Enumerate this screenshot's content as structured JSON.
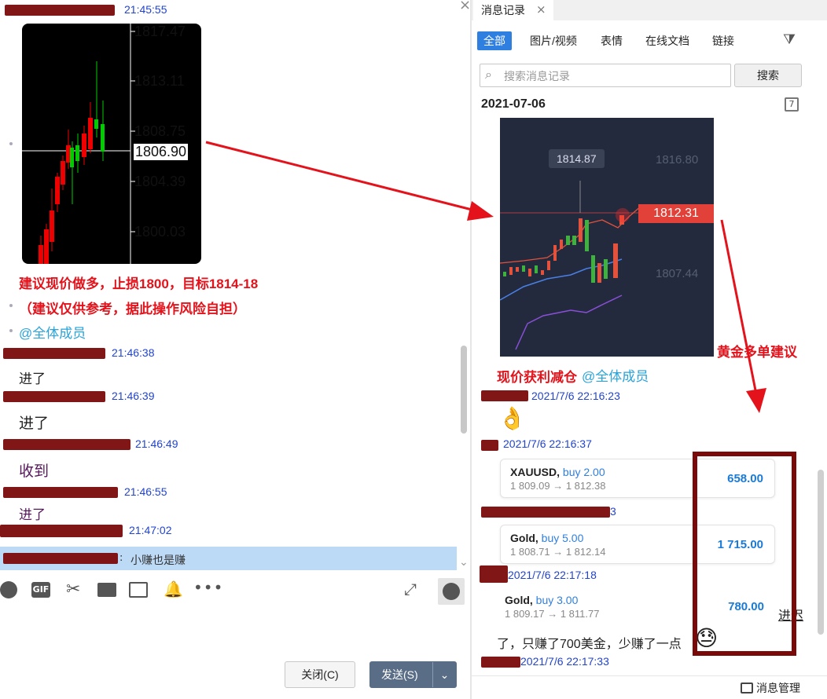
{
  "left": {
    "header_time": "21:45:55",
    "chart1": {
      "prices": [
        "1817.47",
        "1813.11",
        "1808.75",
        "1806.90",
        "1804.39",
        "1800.03"
      ]
    },
    "suggestion_line1": "建议现价做多，止损1800，目标1814-18",
    "suggestion_line2": "（建议仅供参考，据此操作风险自担）",
    "mention": "@全体成员",
    "messages": [
      {
        "time": "21:46:38",
        "text": "进了"
      },
      {
        "time": "21:46:39",
        "text": "进了"
      },
      {
        "time": "21:46:49",
        "text": "收到"
      },
      {
        "time": "21:46:55",
        "text": "进了"
      }
    ],
    "last_time": "21:47:02",
    "quote_text": "小赚也是赚",
    "toolbar_gif": "GIF",
    "close_button": "关闭(C)",
    "send_button": "发送(S)"
  },
  "right": {
    "panel_tab": "消息记录",
    "filter_tabs": [
      "全部",
      "图片/视频",
      "表情",
      "在线文档",
      "链接"
    ],
    "search_placeholder": "搜索消息记录",
    "search_button": "搜索",
    "date": "2021-07-06",
    "chart2": {
      "tooltip": "1814.87",
      "axis": [
        "1816.80",
        "1807.44"
      ],
      "current": "1812.31"
    },
    "annotation_gold": "黄金多单建议",
    "profit_text": "现价获利减仓",
    "mention": "@全体成员",
    "times": [
      "2021/7/6 22:16:23",
      "2021/7/6 22:16:37",
      "2021/7/6 22:17:18",
      "2021/7/6 22:17:33"
    ],
    "time_fragment": "3",
    "trades": [
      {
        "symbol": "XAUUSD",
        "side": "buy 2.00",
        "prices": "1 809.09 → 1 812.38",
        "profit": "658.00"
      },
      {
        "symbol": "Gold",
        "side": "buy 5.00",
        "prices": "1 808.71 → 1 812.14",
        "profit": "1 715.00"
      },
      {
        "symbol": "Gold",
        "side": "buy 3.00",
        "prices": "1 809.17 → 1 811.77",
        "profit": "780.00"
      }
    ],
    "side_text": "进",
    "side_text2": "迟",
    "bottom_message": "了，只赚了700美金，少赚了一点",
    "manage_label": "消息管理"
  },
  "colors": {
    "accent": "#2f7fe0",
    "redaction": "#7a0a0a",
    "alert_red": "#e3121b"
  }
}
